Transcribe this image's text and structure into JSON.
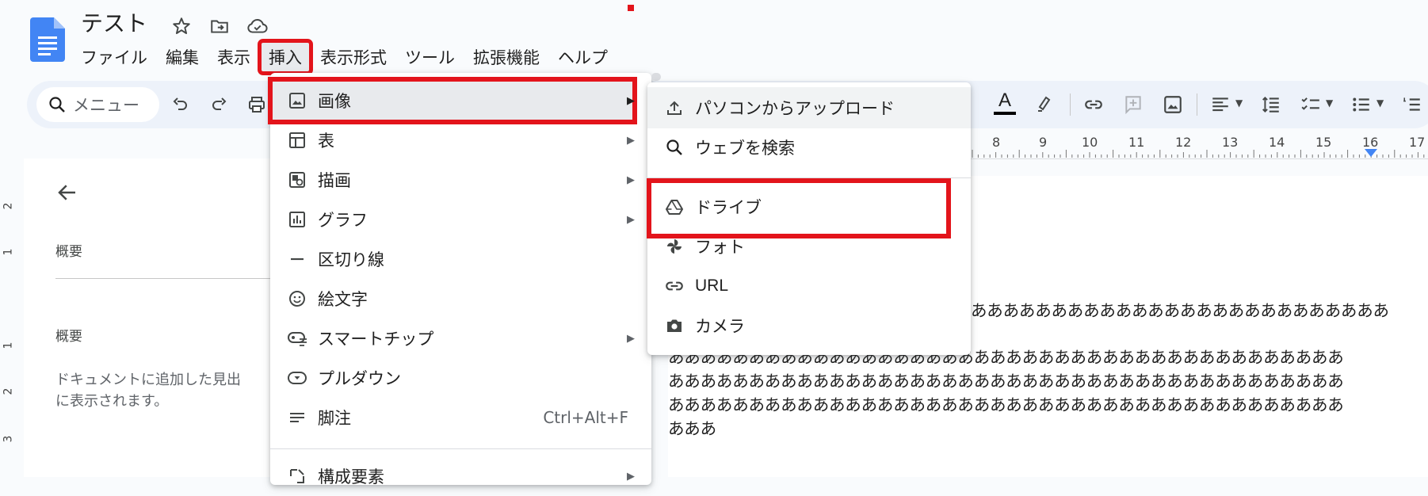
{
  "doc": {
    "title": "テスト"
  },
  "menubar": {
    "items": [
      {
        "label": "ファイル"
      },
      {
        "label": "編集"
      },
      {
        "label": "表示"
      },
      {
        "label": "挿入",
        "selected": true
      },
      {
        "label": "表示形式"
      },
      {
        "label": "ツール"
      },
      {
        "label": "拡張機能"
      },
      {
        "label": "ヘルプ"
      }
    ]
  },
  "toolbar": {
    "search_label": "メニュー",
    "text_color_glyph": "A"
  },
  "ruler": {
    "numbers": [
      "8",
      "9",
      "10",
      "11",
      "12",
      "13",
      "14",
      "15",
      "16",
      "17"
    ]
  },
  "vruler": {
    "numbers": [
      "2",
      "1",
      "1",
      "2",
      "3"
    ]
  },
  "outline": {
    "heading_1": "概要",
    "heading_2": "概要",
    "empty_text_line_1": "ドキュメントに追加した見出",
    "empty_text_line_2": "に表示されます。"
  },
  "document": {
    "lines": [
      "ああああああああああああああああああああああああああ",
      "ああああああああああああああああああああああああああああああああああああああああああ",
      "ああああああああああああああああああああああああああああああああああああああああああ",
      "ああああああああああああああああああああああああああああああああああああああああああ",
      "あああ"
    ]
  },
  "insert_menu": {
    "items": [
      {
        "label": "画像",
        "icon": "image-icon",
        "submenu": true,
        "highlighted": true
      },
      {
        "label": "表",
        "icon": "table-icon",
        "submenu": true
      },
      {
        "label": "描画",
        "icon": "drawing-icon",
        "submenu": true
      },
      {
        "label": "グラフ",
        "icon": "chart-icon",
        "submenu": true
      },
      {
        "label": "区切り線",
        "icon": "horizontal-line-icon",
        "submenu": false
      },
      {
        "label": "絵文字",
        "icon": "emoji-icon",
        "submenu": false
      },
      {
        "label": "スマートチップ",
        "icon": "smart-chip-icon",
        "submenu": true
      },
      {
        "label": "プルダウン",
        "icon": "dropdown-icon",
        "submenu": false
      },
      {
        "label": "脚注",
        "icon": "footnote-icon",
        "submenu": false,
        "shortcut": "Ctrl+Alt+F"
      },
      {
        "label": "構成要素",
        "icon": "building-blocks-icon",
        "submenu": true
      }
    ]
  },
  "image_submenu": {
    "items": [
      {
        "label": "パソコンからアップロード",
        "icon": "upload-icon"
      },
      {
        "label": "ウェブを検索",
        "icon": "search-icon"
      },
      {
        "label": "ドライブ",
        "icon": "drive-icon",
        "highlighted": true
      },
      {
        "label": "フォト",
        "icon": "photos-icon"
      },
      {
        "label": "URL",
        "icon": "link-icon"
      },
      {
        "label": "カメラ",
        "icon": "camera-icon"
      }
    ]
  },
  "colors": {
    "annotation_red": "#e3141b",
    "docs_blue": "#4285f4",
    "toolbar_bg": "#edf2fa"
  }
}
